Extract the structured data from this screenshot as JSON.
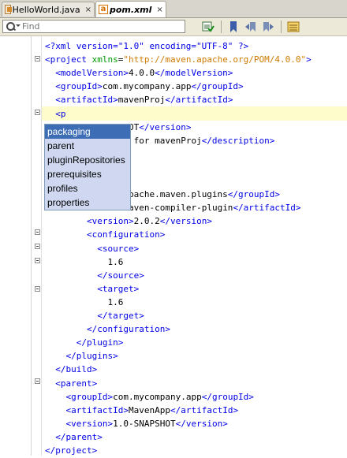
{
  "tabs": [
    {
      "label": "HelloWorld.java",
      "close": "×",
      "active": false
    },
    {
      "label": "pom.xml",
      "close": "×",
      "active": true
    }
  ],
  "search": {
    "placeholder": "Find"
  },
  "code_lines": [
    [
      {
        "c": "pi",
        "t": "<?xml version=\"1.0\" encoding=\"UTF-8\" ?>"
      }
    ],
    [
      {
        "c": "tag",
        "t": "<project"
      },
      {
        "c": "text",
        "t": " "
      },
      {
        "c": "attr",
        "t": "xmlns"
      },
      {
        "c": "text",
        "t": "="
      },
      {
        "c": "str",
        "t": "\"http://maven.apache.org/POM/4.0.0\""
      },
      {
        "c": "tag",
        "t": ">"
      }
    ],
    [
      {
        "c": "text",
        "t": "  "
      },
      {
        "c": "tag",
        "t": "<modelVersion>"
      },
      {
        "c": "text",
        "t": "4.0.0"
      },
      {
        "c": "tag",
        "t": "</modelVersion>"
      }
    ],
    [
      {
        "c": "text",
        "t": "  "
      },
      {
        "c": "tag",
        "t": "<groupId>"
      },
      {
        "c": "text",
        "t": "com.mycompany.app"
      },
      {
        "c": "tag",
        "t": "</groupId>"
      }
    ],
    [
      {
        "c": "text",
        "t": "  "
      },
      {
        "c": "tag",
        "t": "<artifactId>"
      },
      {
        "c": "text",
        "t": "mavenProj"
      },
      {
        "c": "tag",
        "t": "</artifactId>"
      }
    ],
    [
      {
        "c": "text",
        "t": "  "
      },
      {
        "c": "tag",
        "t": "<p"
      }
    ],
    [
      {
        "c": "text",
        "t": "          "
      },
      {
        "c": "text",
        "t": "SNAPSHOT"
      },
      {
        "c": "tag",
        "t": "</version>"
      }
    ],
    [
      {
        "c": "text",
        "t": "          "
      },
      {
        "c": "text",
        "t": "roject for mavenProj"
      },
      {
        "c": "tag",
        "t": "</description>"
      }
    ],
    [],
    [],
    [],
    [
      {
        "c": "text",
        "t": "          "
      },
      {
        "c": "tag",
        "t": ">"
      },
      {
        "c": "text",
        "t": "org.apache.maven.plugins"
      },
      {
        "c": "tag",
        "t": "</groupId>"
      }
    ],
    [
      {
        "c": "text",
        "t": "          "
      },
      {
        "c": "tag",
        "t": "ctId>"
      },
      {
        "c": "text",
        "t": "maven-compiler-plugin"
      },
      {
        "c": "tag",
        "t": "</artifactId>"
      }
    ],
    [
      {
        "c": "text",
        "t": "        "
      },
      {
        "c": "tag",
        "t": "<version>"
      },
      {
        "c": "text",
        "t": "2.0.2"
      },
      {
        "c": "tag",
        "t": "</version>"
      }
    ],
    [
      {
        "c": "text",
        "t": "        "
      },
      {
        "c": "tag",
        "t": "<configuration>"
      }
    ],
    [
      {
        "c": "text",
        "t": "          "
      },
      {
        "c": "tag",
        "t": "<source>"
      }
    ],
    [
      {
        "c": "text",
        "t": "            "
      },
      {
        "c": "text",
        "t": "1.6"
      }
    ],
    [
      {
        "c": "text",
        "t": "          "
      },
      {
        "c": "tag",
        "t": "</source>"
      }
    ],
    [
      {
        "c": "text",
        "t": "          "
      },
      {
        "c": "tag",
        "t": "<target>"
      }
    ],
    [
      {
        "c": "text",
        "t": "            "
      },
      {
        "c": "text",
        "t": "1.6"
      }
    ],
    [
      {
        "c": "text",
        "t": "          "
      },
      {
        "c": "tag",
        "t": "</target>"
      }
    ],
    [
      {
        "c": "text",
        "t": "        "
      },
      {
        "c": "tag",
        "t": "</configuration>"
      }
    ],
    [
      {
        "c": "text",
        "t": "      "
      },
      {
        "c": "tag",
        "t": "</plugin>"
      }
    ],
    [
      {
        "c": "text",
        "t": "    "
      },
      {
        "c": "tag",
        "t": "</plugins>"
      }
    ],
    [
      {
        "c": "text",
        "t": "  "
      },
      {
        "c": "tag",
        "t": "</build>"
      }
    ],
    [
      {
        "c": "text",
        "t": "  "
      },
      {
        "c": "tag",
        "t": "<parent>"
      }
    ],
    [
      {
        "c": "text",
        "t": "    "
      },
      {
        "c": "tag",
        "t": "<groupId>"
      },
      {
        "c": "text",
        "t": "com.mycompany.app"
      },
      {
        "c": "tag",
        "t": "</groupId>"
      }
    ],
    [
      {
        "c": "text",
        "t": "    "
      },
      {
        "c": "tag",
        "t": "<artifactId>"
      },
      {
        "c": "text",
        "t": "MavenApp"
      },
      {
        "c": "tag",
        "t": "</artifactId>"
      }
    ],
    [
      {
        "c": "text",
        "t": "    "
      },
      {
        "c": "tag",
        "t": "<version>"
      },
      {
        "c": "text",
        "t": "1.0-SNAPSHOT"
      },
      {
        "c": "tag",
        "t": "</version>"
      }
    ],
    [
      {
        "c": "text",
        "t": "  "
      },
      {
        "c": "tag",
        "t": "</parent>"
      }
    ],
    [
      {
        "c": "tag",
        "t": "</project>"
      }
    ]
  ],
  "completion": {
    "items": [
      "packaging",
      "parent",
      "pluginRepositories",
      "prerequisites",
      "profiles",
      "properties"
    ],
    "selected": "packaging"
  },
  "colors": {
    "tag": "#0000e6",
    "attr": "#009900",
    "string": "#ce7b00",
    "selection": "#3d6db5",
    "popup_bg": "#cfd8f0",
    "current_line": "#fffccc"
  }
}
